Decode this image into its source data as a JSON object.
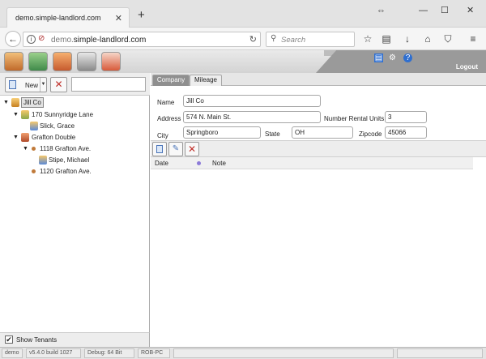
{
  "browser": {
    "tab_title": "demo.simple-landlord.com",
    "tab_close": "✕",
    "new_tab": "+",
    "url_host": "demo.",
    "url_domain": "simple-landlord.com",
    "search_placeholder": "Search",
    "icons": [
      "back-icon",
      "info-icon",
      "insecure-icon",
      "reload-icon",
      "search-icon",
      "star-icon",
      "reading-list-icon",
      "download-icon",
      "home-icon",
      "pocket-icon",
      "menu-icon"
    ]
  },
  "app": {
    "header": {
      "logout_label": "Logout",
      "nav_icons": [
        "properties-icon",
        "tenants-icon",
        "help-people-icon",
        "settings-robot-icon",
        "reports-icon"
      ]
    },
    "left_toolbar": {
      "new_label": "New",
      "search_value": ""
    },
    "tree": {
      "root": "Jill Co",
      "items": [
        "170 Sunnyridge Lane",
        "Slick, Grace",
        "Grafton Double",
        "1118 Grafton Ave.",
        "Stipe, Michael",
        "1120 Grafton Ave."
      ]
    },
    "left_footer": {
      "show_tenants_label": "Show Tenants",
      "show_tenants_checked": "✔"
    },
    "tabs": [
      "Company",
      "Mileage"
    ],
    "form": {
      "name_label": "Name",
      "name_value": "Jill Co",
      "address_label": "Address",
      "address_value": "574 N. Main St.",
      "units_label": "Number Rental Units",
      "units_value": "3",
      "city_label": "City",
      "city_value": "Springboro",
      "state_label": "State",
      "state_value": "OH",
      "zip_label": "Zipcode",
      "zip_value": "45066"
    },
    "grid": {
      "columns": [
        "Date",
        "Note"
      ]
    },
    "status": {
      "user": "demo",
      "version": "v5.4.0 build 1027",
      "debug": "Debug: 64 Bit",
      "machine": "ROB-PC"
    },
    "colors": {
      "header_gray": "#9a9a9a",
      "delete_red": "#c0302a",
      "note_dot": "#8c7ad8"
    }
  }
}
